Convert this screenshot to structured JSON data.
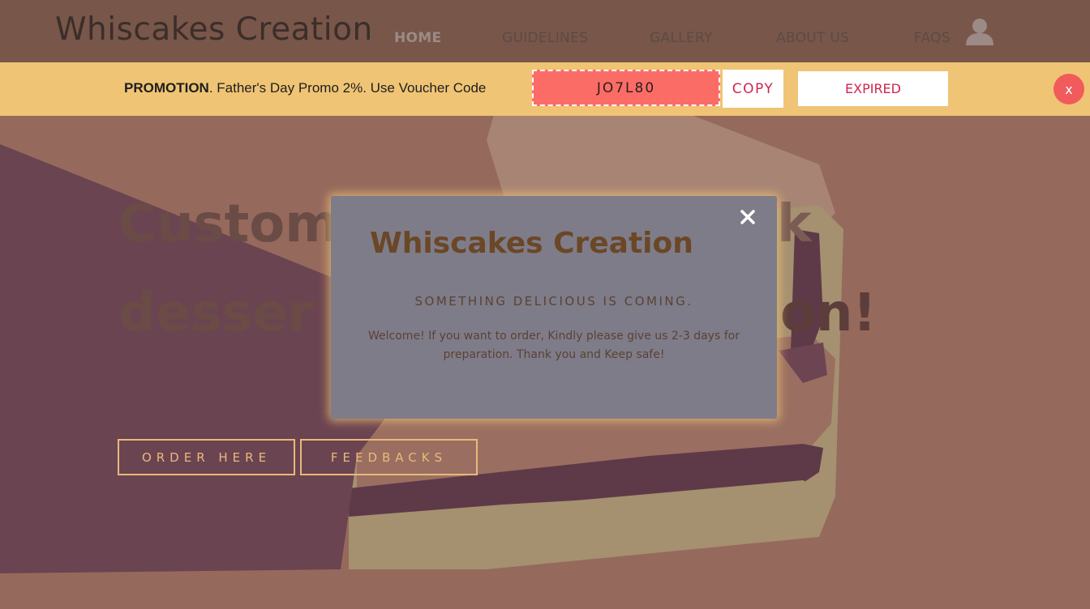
{
  "header": {
    "brand": "Whiscakes Creation",
    "nav": [
      "HOME",
      "GUIDELINES",
      "GALLERY",
      "ABOUT US",
      "FAQS"
    ],
    "active_nav": "HOME",
    "account_icon": "user-icon"
  },
  "promo": {
    "label": "PROMOTION",
    "text": ". Father's Day Promo 2%. Use Voucher Code",
    "voucher_code": "JO7L80",
    "copy_label": "COPY",
    "status_label": "EXPIRED",
    "close_label": "x"
  },
  "hero": {
    "headline_line1": "Custom",
    "headline_line1_end": "k",
    "headline_line2": "desser",
    "headline_line2_end": "ion!",
    "buttons": [
      "ORDER HERE",
      "FEEDBACKS"
    ]
  },
  "modal": {
    "title": "Whiscakes Creation",
    "subtitle": "SOMETHING DELICIOUS IS COMING.",
    "message": "Welcome! If you want to order, Kindly please give us 2-3 days for preparation. Thank you and Keep safe!",
    "close_icon": "close-icon"
  },
  "colors": {
    "header_bg": "#785649",
    "promo_bg": "#f0c475",
    "voucher_bg": "#fc6c66",
    "accent_red": "#d0254f",
    "modal_bg": "#7e7c88",
    "modal_text": "#6b4727",
    "button_outline": "#e8b97a"
  }
}
